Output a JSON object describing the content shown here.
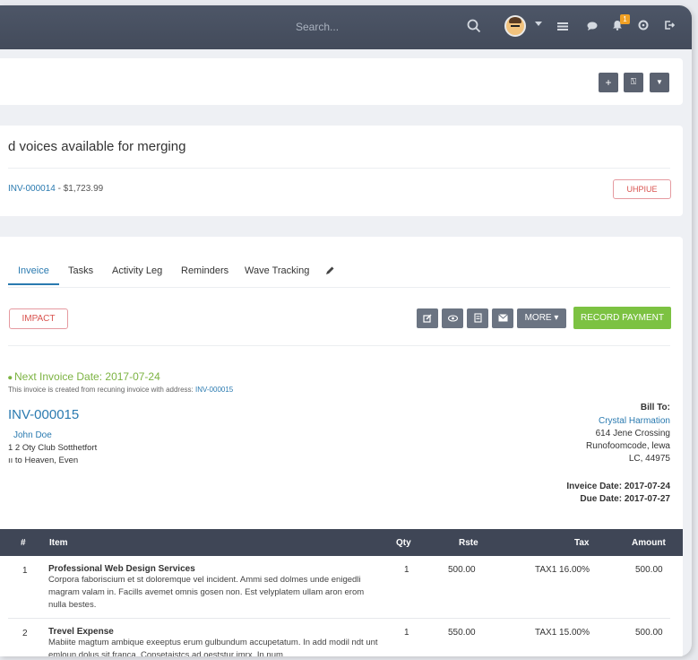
{
  "topbar": {
    "search_placeholder": "Search...",
    "notification_count": "1"
  },
  "toolbar": {
    "add_label": "+",
    "chart_label": "⍂",
    "filter_label": "▼"
  },
  "merge_card": {
    "title": "d voices available for merging",
    "invoice_ref": "INV-000014",
    "invoice_amount": " - $1,723.99",
    "unpin_label": "UHPIUE"
  },
  "tabs": [
    {
      "label": "Inveice"
    },
    {
      "label": "Tasks"
    },
    {
      "label": "Activity Leg"
    },
    {
      "label": "Reminders"
    },
    {
      "label": "Wave Tracking"
    }
  ],
  "actions": {
    "impact_label": "IMPACT",
    "more_label": "MORE ▾",
    "record_payment_label": "RECORD PAYMENT"
  },
  "invoice": {
    "next_invoice_date": "Next Invoice Date: 2017-07-24",
    "recurring_note": "This invoice is created from recuning invoice with address: ",
    "recurring_link": "INV-000015",
    "number": "INV-000015",
    "from_name": "John Doe",
    "from_line1": "1 2 Oty Club Sotthetfort",
    "from_line2": "ıı to Heaven, Even",
    "bill_to_label": "Bill To:",
    "bill_to_name": "Crystal Harmation",
    "bill_to_line1": "614 Jene Crossing",
    "bill_to_line2": "Runofoomcode, lewa",
    "bill_to_line3": "LC, 44975",
    "invoice_date": "Inveice Date: 2017-07-24",
    "due_date": "Due Date: 2017-07-27"
  },
  "table": {
    "headers": [
      "#",
      "Item",
      "Qty",
      "Rste",
      "Tax",
      "Amount"
    ],
    "rows": [
      {
        "num": "1",
        "title": "Professional Web Design Services",
        "desc": "Corpora faboriscium et st doloremque vel incident. Ammi sed dolmes unde enigedli magram valam in. Facills avemet omnis gosen non. Est velyplatem ullam aron erom nulla bestes.",
        "qty": "1",
        "rate": "500.00",
        "tax": "TAX1 16.00%",
        "amount": "500.00"
      },
      {
        "num": "2",
        "title": "Trevel Expense",
        "desc": "Mabiite magtum ambique exeeptus erum gulbundum accupetatum. In add modil ndt unt emloun dolus sit franca. Consetaistcs ad oeststur imrx. In num",
        "qty": "1",
        "rate": "550.00",
        "tax": "TAX1 15.00%",
        "amount": "500.00"
      }
    ]
  }
}
